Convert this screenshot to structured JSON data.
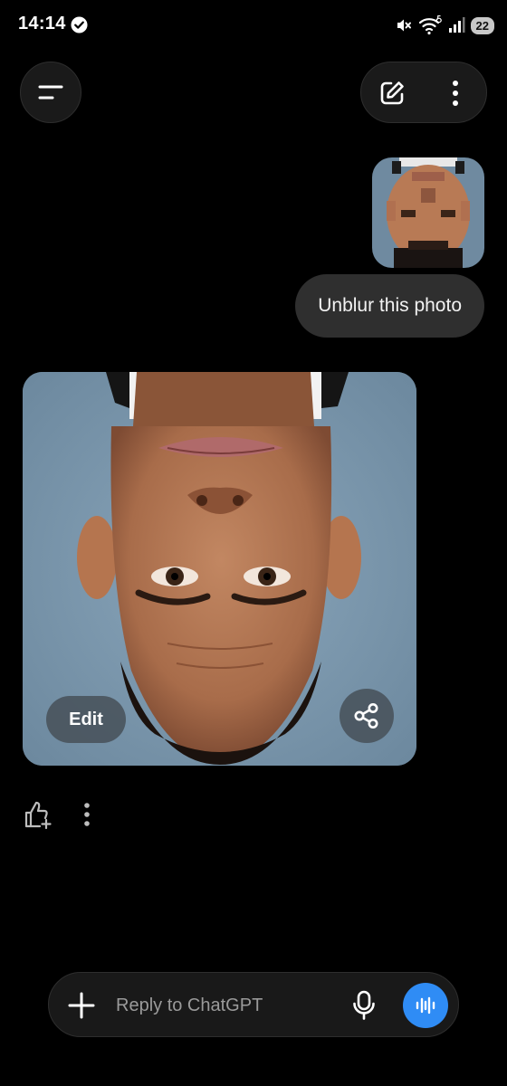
{
  "status_bar": {
    "time": "14:14",
    "battery": "22",
    "icons": [
      "check-circle-icon",
      "mute-icon",
      "wifi-6-icon",
      "signal-icon",
      "battery-icon"
    ]
  },
  "header": {
    "icons": [
      "menu-icon",
      "compose-icon",
      "more-vertical-icon"
    ]
  },
  "user_message": {
    "text": "Unblur this photo",
    "attachment": "blurred portrait photo"
  },
  "assistant_message": {
    "image": "generated portrait photo",
    "edit_label": "Edit",
    "icons": [
      "share-icon",
      "like-icon",
      "more-vertical-icon"
    ]
  },
  "composer": {
    "placeholder": "Reply to ChatGPT",
    "value": "",
    "icons": [
      "plus-icon",
      "microphone-icon",
      "voice-wave-icon"
    ]
  },
  "colors": {
    "background": "#000000",
    "bubble": "#2f2f2f",
    "pill": "#1a1a1a",
    "accent_blue": "#2f8cf5",
    "photo_backdrop": "#7d98ad"
  }
}
